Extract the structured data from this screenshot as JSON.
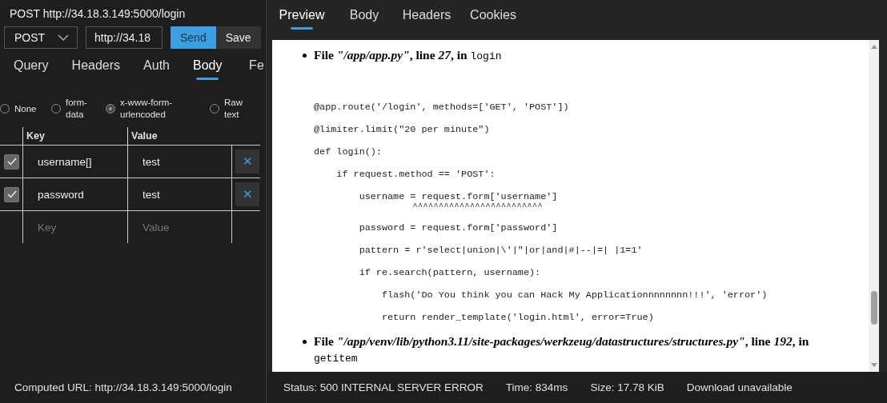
{
  "request": {
    "title": "POST http://34.18.3.149:5000/login",
    "method": "POST",
    "url": "http://34.18",
    "send": "Send",
    "save": "Save"
  },
  "request_tabs": [
    {
      "label": "Query",
      "selected": false
    },
    {
      "label": "Headers",
      "selected": false
    },
    {
      "label": "Auth",
      "selected": false
    },
    {
      "label": "Body",
      "selected": true
    },
    {
      "label": "Fe",
      "selected": false
    }
  ],
  "body_types": [
    {
      "label": "None",
      "selected": false
    },
    {
      "label": "form-\ndata",
      "selected": false
    },
    {
      "label": "x-www-form-\nurlencoded",
      "selected": true
    },
    {
      "label": "Raw\ntext",
      "selected": false
    }
  ],
  "params": {
    "columns": [
      "Key",
      "Value"
    ],
    "rows": [
      {
        "key": "username[]",
        "value": "test",
        "checked": true,
        "remove": "✕"
      },
      {
        "key": "password",
        "value": "test",
        "checked": true,
        "remove": "✕"
      }
    ],
    "new_row": {
      "key_placeholder": "Key",
      "value_placeholder": "Value"
    }
  },
  "computed_url": "Computed URL: http://34.18.3.149:5000/login",
  "response_tabs": [
    {
      "label": "Preview",
      "selected": true
    },
    {
      "label": "Body",
      "selected": false
    },
    {
      "label": "Headers",
      "selected": false
    },
    {
      "label": "Cookies",
      "selected": false
    }
  ],
  "traceback": [
    {
      "header": "File *\"/app/app.py\"*, line *27*, in",
      "function": "login",
      "code": [
        {
          "kind": "code",
          "text": "@app.route('/login', methods=['GET', 'POST'])"
        },
        {
          "kind": "code",
          "text": "@limiter.limit(\"20 per minute\")"
        },
        {
          "kind": "code",
          "text": "def login():"
        },
        {
          "kind": "code",
          "text": "    if request.method == 'POST':"
        },
        {
          "kind": "code",
          "text": "        username = request.form['username']"
        },
        {
          "kind": "marker",
          "text": "                   ^^^^^^^^^^^^^^^^^^^^^^^^^"
        },
        {
          "kind": "code",
          "text": "        password = request.form['password']"
        },
        {
          "kind": "code",
          "text": "        pattern = r'select|union|\\'|\"|or|and|#|--|=| |1=1'"
        },
        {
          "kind": "code",
          "text": "        if re.search(pattern, username):"
        },
        {
          "kind": "code",
          "text": "            flash('Do You think you can Hack My Applicationnnnnnnn!!!', 'error')"
        },
        {
          "kind": "code",
          "text": "            return render_template('login.html', error=True)"
        }
      ]
    },
    {
      "header": "File *\"/app/venv/lib/python3.11/site-packages/werkzeug/datastructures/structures.py\"*, line *192*, in",
      "function": "getitem"
    }
  ],
  "status_bar": {
    "status": "Status: 500 INTERNAL SERVER ERROR",
    "time": "Time: 834ms",
    "size": "Size: 17.78 KiB",
    "download": "Download unavailable"
  }
}
